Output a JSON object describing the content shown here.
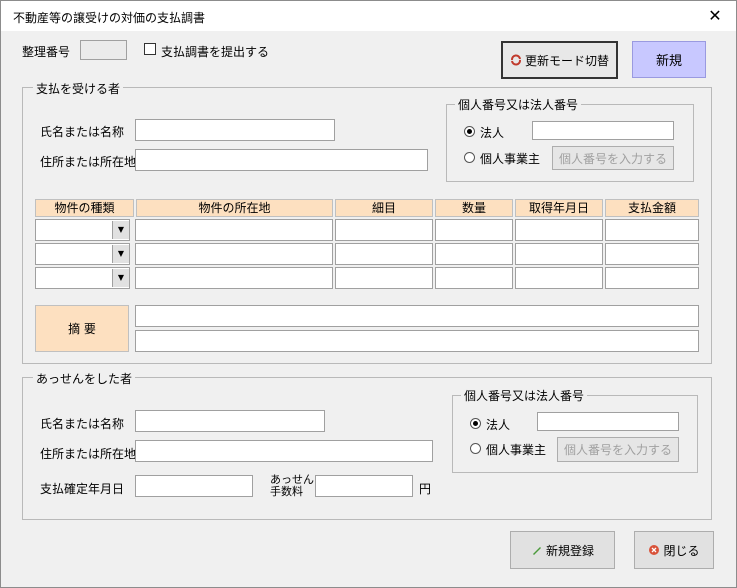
{
  "window": {
    "title": "不動産等の譲受けの対価の支払調書",
    "close_glyph": "✕"
  },
  "top": {
    "seiri_label": "整理番号",
    "seiri_value": "",
    "submit_checkbox_label": "支払調書を提出する",
    "switch_mode_button": "更新モード切替",
    "new_badge": "新規"
  },
  "payee": {
    "group_label": "支払を受ける者",
    "name_label": "氏名または名称",
    "address_label": "住所または所在地",
    "id_group_label": "個人番号又は法人番号",
    "radio_corp": "法人",
    "radio_individual": "個人事業主",
    "enter_id_button": "個人番号を入力する"
  },
  "table": {
    "headers": [
      "物件の種類",
      "物件の所在地",
      "細目",
      "数量",
      "取得年月日",
      "支払金額"
    ],
    "rows": [
      [
        "",
        "",
        "",
        "",
        "",
        ""
      ],
      [
        "",
        "",
        "",
        "",
        "",
        ""
      ],
      [
        "",
        "",
        "",
        "",
        "",
        ""
      ]
    ],
    "summary_label": "摘 要"
  },
  "broker": {
    "group_label": "あっせんをした者",
    "name_label": "氏名または名称",
    "address_label": "住所または所在地",
    "confirm_date_label": "支払確定年月日",
    "fee_label_line1": "あっせん",
    "fee_label_line2": "手数料",
    "yen_label": "円",
    "id_group_label": "個人番号又は法人番号",
    "radio_corp": "法人",
    "radio_individual": "個人事業主",
    "enter_id_button": "個人番号を入力する"
  },
  "footer": {
    "register_button": "新規登録",
    "close_button": "閉じる"
  },
  "colors": {
    "header_fill": "#fde0c0",
    "new_badge_fill": "#c8c8ff"
  }
}
